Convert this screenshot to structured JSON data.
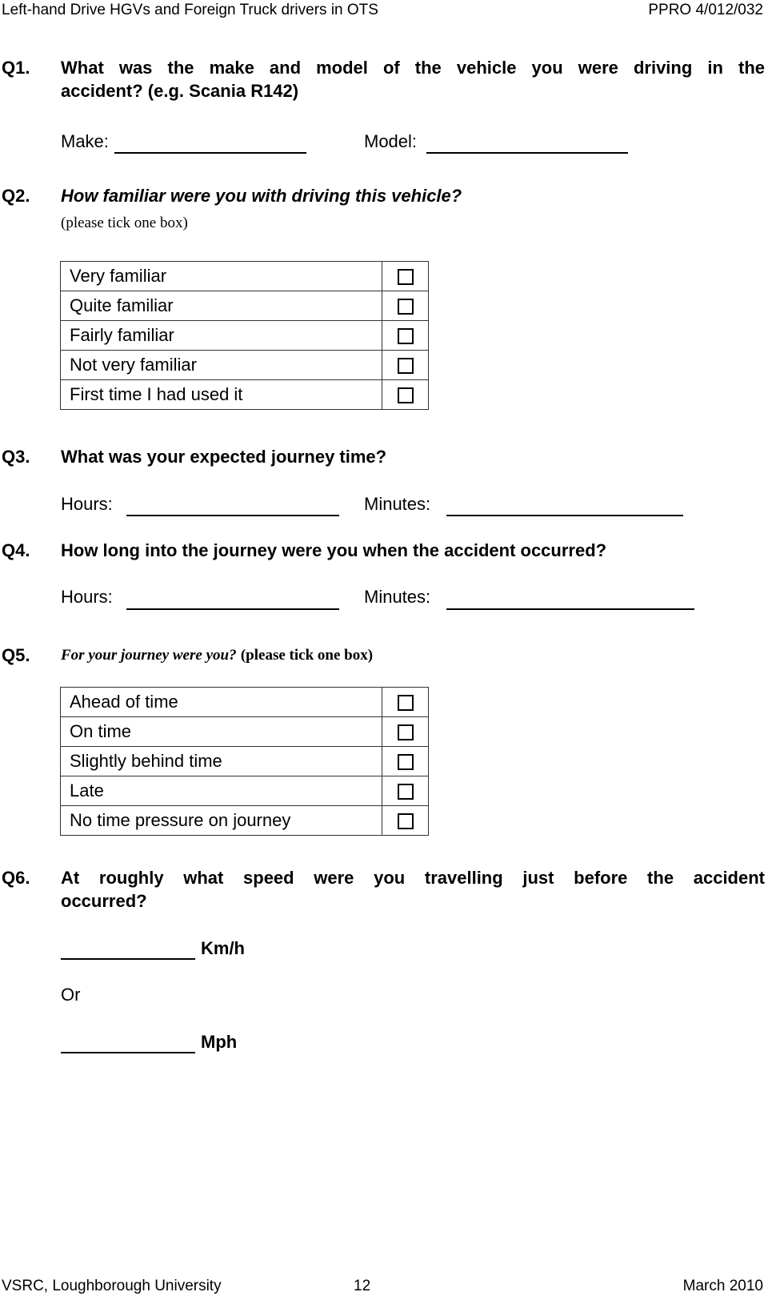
{
  "header": {
    "title": "Left-hand Drive HGVs and Foreign Truck drivers in OTS",
    "ref": "PPRO 4/012/032"
  },
  "q1": {
    "number": "Q1.",
    "text_line1": "What was the make and model of the vehicle you were driving in the",
    "text_line2": "accident? (e.g. Scania R142)",
    "make_label": "Make:",
    "make_value": "",
    "model_label": "Model:",
    "model_value": ""
  },
  "q2": {
    "number": "Q2.",
    "text": "How familiar were you with driving this vehicle?",
    "instruction": "(please tick one box)",
    "options": [
      {
        "label": "Very familiar",
        "checked": false
      },
      {
        "label": "Quite familiar",
        "checked": false
      },
      {
        "label": "Fairly familiar",
        "checked": false
      },
      {
        "label": "Not very familiar",
        "checked": false
      },
      {
        "label": "First time I had used it",
        "checked": false
      }
    ]
  },
  "q3": {
    "number": "Q3.",
    "text": "What was your expected journey time?",
    "hours_label": "Hours:",
    "hours_value": "",
    "minutes_label": "Minutes:",
    "minutes_value": ""
  },
  "q4": {
    "number": "Q4.",
    "text": "How long into the journey were you when the accident occurred?",
    "hours_label": "Hours:",
    "hours_value": "",
    "minutes_label": "Minutes:",
    "minutes_value": ""
  },
  "q5": {
    "number": "Q5.",
    "text": "For your journey were you?",
    "instruction": "(please tick one box)",
    "options": [
      {
        "label": "Ahead of time",
        "checked": false
      },
      {
        "label": "On time",
        "checked": false
      },
      {
        "label": "Slightly behind time",
        "checked": false
      },
      {
        "label": "Late",
        "checked": false
      },
      {
        "label": "No time pressure on journey",
        "checked": false
      }
    ]
  },
  "q6": {
    "number": "Q6.",
    "text_line1": "At roughly what speed were you travelling just before the accident",
    "text_line2": "occurred?",
    "kmh_unit": "Km/h",
    "kmh_value": "",
    "or_label": "Or",
    "mph_unit": "Mph",
    "mph_value": ""
  },
  "footer": {
    "org": "VSRC, Loughborough University",
    "page": "12",
    "date": "March 2010"
  }
}
